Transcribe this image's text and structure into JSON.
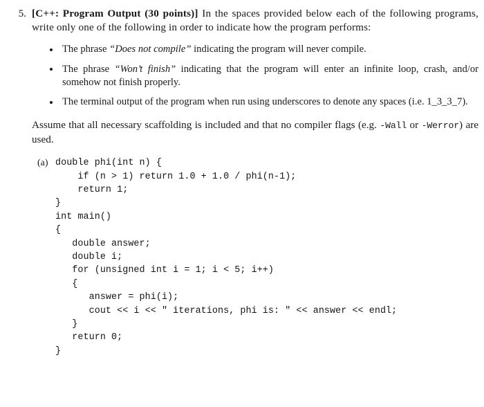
{
  "problem": {
    "number": "5.",
    "header": {
      "open_bracket": "[",
      "title_bold": "C++: Program Output (30 points)",
      "close_bracket": "]"
    },
    "intro_text": " In the spaces provided below each of the following programs, write only one of the following in order to indicate how the program performs:",
    "choices": [
      {
        "lead": "The phrase ",
        "quoted": "“Does not compile”",
        "tail": " indicating the program will never compile."
      },
      {
        "lead": "The phrase ",
        "quoted": "“Won’t finish”",
        "tail": " indicating that the program will enter an infinite loop, crash, and/or somehow not finish properly."
      },
      {
        "lead": "The terminal output of the program when run using underscores to denote any spaces (i.e. 1_3_3_7).",
        "quoted": "",
        "tail": ""
      }
    ],
    "assume": {
      "part1": "Assume that all necessary scaffolding is included and that no compiler flags (e.g. ",
      "flag1": "-Wall",
      "part2": " or ",
      "flag2": "-Werror",
      "part3": ") are used."
    },
    "listing": {
      "label": "(a)",
      "language": "cpp",
      "code": "double phi(int n) {\n    if (n > 1) return 1.0 + 1.0 / phi(n-1);\n    return 1;\n}\nint main()\n{\n   double answer;\n   double i;\n   for (unsigned int i = 1; i < 5; i++)\n   {\n      answer = phi(i);\n      cout << i << \" iterations, phi is: \" << answer << endl;\n   }\n   return 0;\n}"
    }
  },
  "colors": {
    "page_background": "#ffffff",
    "text": "#1a1a1a",
    "code_text": "#151515"
  }
}
